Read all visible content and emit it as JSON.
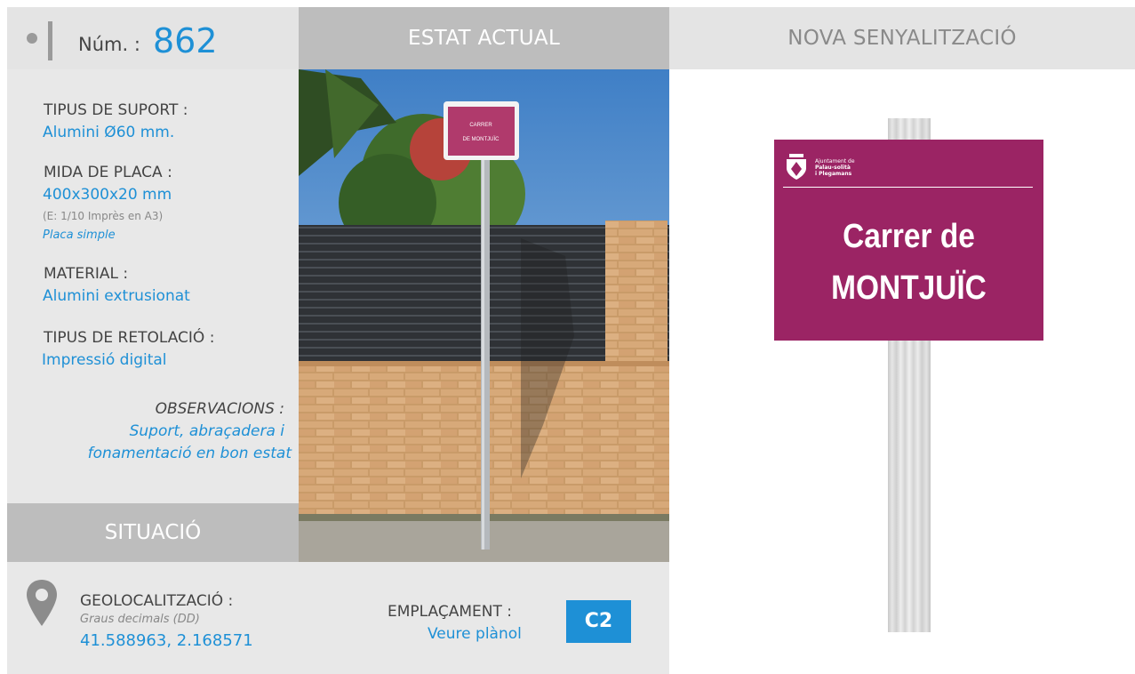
{
  "header": {
    "num_label": "Núm. :",
    "num_value": "862",
    "current_state": "ESTAT ACTUAL",
    "new_signage": "NOVA SENYALITZACIÓ"
  },
  "info": {
    "support_label": "TIPUS DE SUPORT :",
    "support_value": "Alumini Ø60 mm.",
    "plate_label": "MIDA DE PLACA :",
    "plate_value": "400x300x20 mm",
    "plate_scale": "(E: 1/10 Imprès en A3)",
    "plate_type": "Placa simple",
    "material_label": "MATERIAL :",
    "material_value": "Alumini extrusionat",
    "lettering_label": "TIPUS DE RETOLACIÓ :",
    "lettering_value": "Impressió digital",
    "observations_label": "OBSERVACIONS :",
    "observations_line1": "Suport, abraçadera i",
    "observations_line2": "fonamentació en bon estat"
  },
  "situation": {
    "title": "SITUACIÓ",
    "geo_label": "GEOLOCALITZACIÓ :",
    "geo_format": "Graus decimals (DD)",
    "geo_value": "41.588963, 2.168571",
    "location_label": "EMPLAÇAMENT :",
    "location_link": "Veure plànol",
    "location_code": "C2"
  },
  "photo": {
    "sign_line1": "CARRER",
    "sign_line2": "DE MONTJUÏC"
  },
  "new_sign": {
    "org_line1": "Ajuntament de",
    "org_line2": "Palau-solità",
    "org_line3": "i Plegamans",
    "line1": "Carrer de",
    "line2": "MONTJUÏC"
  },
  "colors": {
    "accent_blue": "#1e90d6",
    "sign_magenta": "#9b2464",
    "header_gray": "#bdbdbd",
    "panel_gray": "#e8e8e8"
  },
  "icons": [
    "location-pin-icon",
    "bullet-dot-icon",
    "municipal-shield-icon"
  ]
}
